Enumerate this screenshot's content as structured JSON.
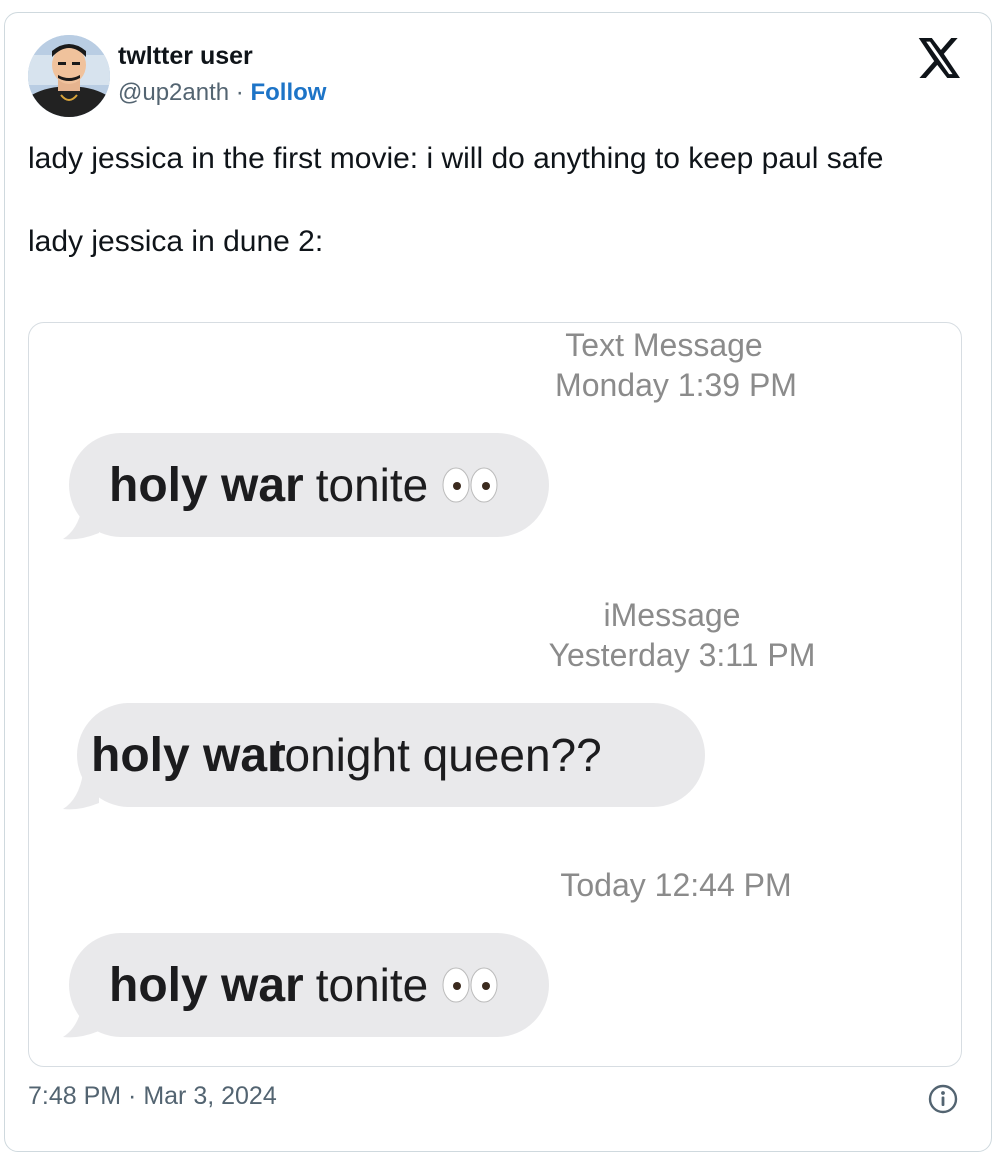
{
  "author": {
    "display_name": "twltter user",
    "handle": "@up2anth",
    "separator": "·",
    "follow_label": "Follow"
  },
  "tweet": {
    "line1": "lady jessica in the first movie: i will do anything to keep paul safe",
    "line2": "lady jessica in dune 2:"
  },
  "messages": {
    "header1_service": "Text Message",
    "header1_time": "Monday 1:39 PM",
    "bubble1_bold": "holy war",
    "bubble1_rest": "tonite",
    "header2_service": "iMessage",
    "header2_time": "Yesterday 3:11 PM",
    "bubble2_bold": "holy wa",
    "bubble2_overlap": "r",
    "bubble2_rest": "tonight queen??",
    "header3_time": "Today 12:44 PM",
    "bubble3_bold": "holy war",
    "bubble3_rest": "tonite",
    "emoji_name": "eyes-emoji"
  },
  "footer": {
    "timestamp": "7:48 PM · Mar 3, 2024"
  },
  "icons": {
    "platform": "x-logo-icon",
    "info": "info-icon"
  },
  "colors": {
    "follow": "#1d74c7",
    "bubble": "#e9e9eb",
    "meta_text": "#8b8b8b"
  }
}
